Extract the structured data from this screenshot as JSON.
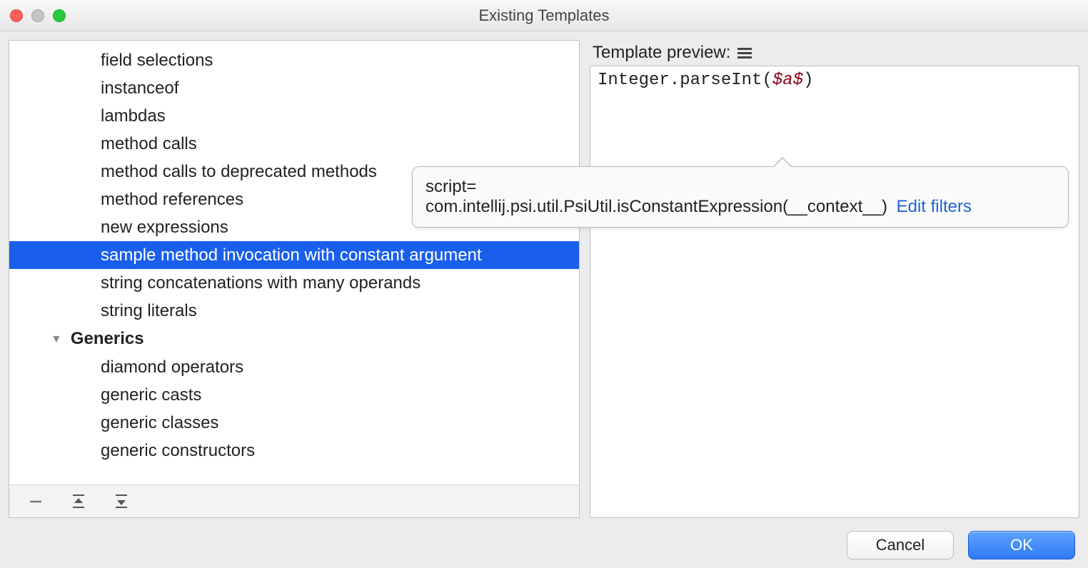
{
  "window": {
    "title": "Existing Templates"
  },
  "tree": {
    "items": [
      {
        "label": "field selections",
        "selected": false
      },
      {
        "label": "instanceof",
        "selected": false
      },
      {
        "label": "lambdas",
        "selected": false
      },
      {
        "label": "method calls",
        "selected": false
      },
      {
        "label": "method calls to deprecated methods",
        "selected": false
      },
      {
        "label": "method references",
        "selected": false
      },
      {
        "label": "new expressions",
        "selected": false
      },
      {
        "label": "sample method invocation with constant argument",
        "selected": true
      },
      {
        "label": "string concatenations with many operands",
        "selected": false
      },
      {
        "label": "string literals",
        "selected": false
      }
    ],
    "group": {
      "label": "Generics",
      "expanded": true
    },
    "group_items": [
      {
        "label": "diamond operators"
      },
      {
        "label": "generic casts"
      },
      {
        "label": "generic classes"
      },
      {
        "label": "generic constructors"
      }
    ]
  },
  "preview": {
    "header_label": "Template preview:",
    "code_prefix": "Integer.parseInt(",
    "code_var": "$a$",
    "code_suffix": ")"
  },
  "tooltip": {
    "line1": "script=",
    "line2_text": "com.intellij.psi.util.PsiUtil.isConstantExpression(__context__)",
    "link": "Edit filters"
  },
  "buttons": {
    "cancel": "Cancel",
    "ok": "OK"
  }
}
